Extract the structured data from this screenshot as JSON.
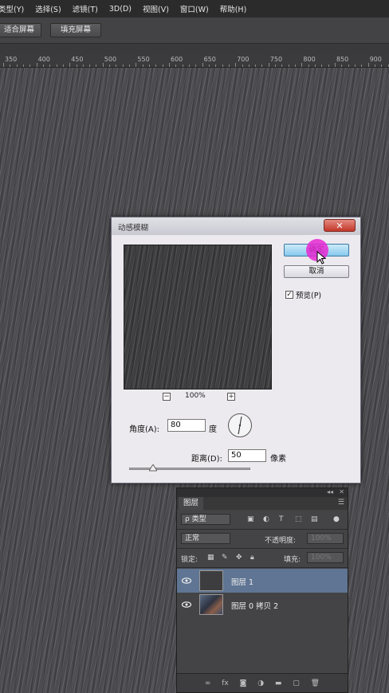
{
  "menubar": {
    "items": [
      "类型(Y)",
      "选择(S)",
      "滤镜(T)",
      "3D(D)",
      "视图(V)",
      "窗口(W)",
      "帮助(H)"
    ]
  },
  "options_bar": {
    "fit_screen_label": "适合屏幕",
    "fill_screen_label": "填充屏幕"
  },
  "ruler": {
    "labels": [
      "350",
      "400",
      "450",
      "500",
      "550",
      "600",
      "650",
      "700",
      "750",
      "800",
      "850",
      "900"
    ]
  },
  "dialog": {
    "title": "动感模糊",
    "close_label": "✕",
    "ok_label": "确定",
    "cancel_label": "取消",
    "preview_label": "预览(P)",
    "preview_checked": true,
    "zoom_minus": "−",
    "zoom_plus": "+",
    "zoom_level": "100%",
    "angle_label": "角度(A):",
    "angle_value": "80",
    "angle_unit": "度",
    "distance_label": "距离(D):",
    "distance_value": "50",
    "distance_unit": "像素",
    "distance_slider_fraction": 0.2
  },
  "layers_panel": {
    "tab_label": "图层",
    "filter_kind": "ρ 类型",
    "blend_mode": "正常",
    "opacity_label": "不透明度:",
    "opacity_value": "100%",
    "lock_label": "锁定:",
    "fill_label": "填充:",
    "fill_value": "100%",
    "layers": [
      {
        "name": "图层 1",
        "selected": true
      },
      {
        "name": "图层 0 拷贝 2",
        "selected": false
      }
    ],
    "bottom_icons": [
      "link-icon",
      "fx-icon",
      "mask-icon",
      "adjustment-icon",
      "group-icon",
      "new-layer-icon",
      "trash-icon"
    ]
  }
}
